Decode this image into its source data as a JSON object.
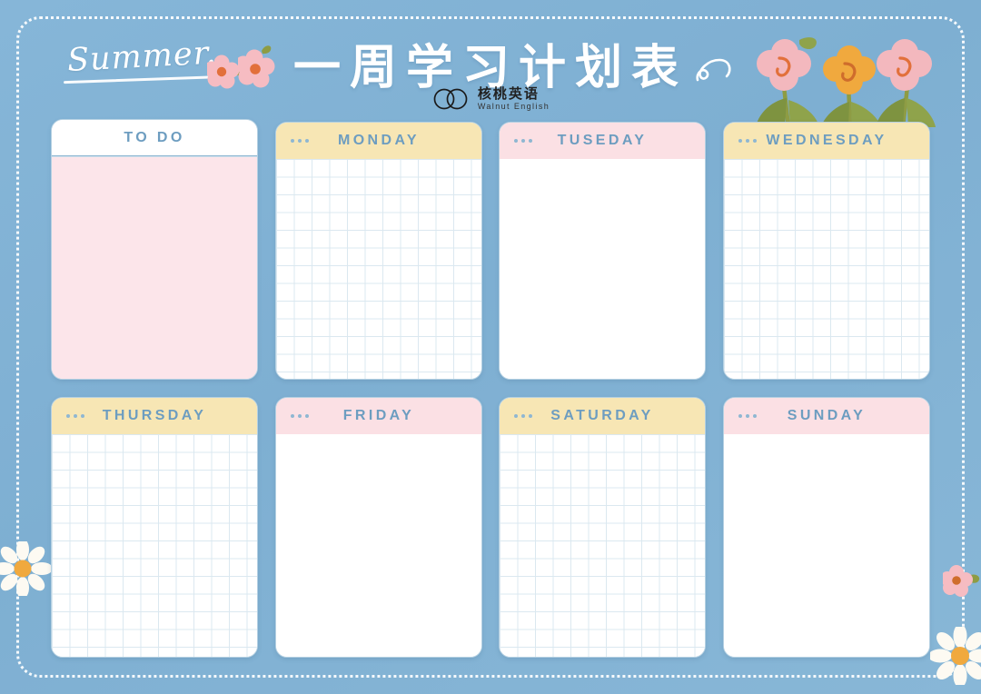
{
  "page": {
    "background_color": "#7fb1d4",
    "border_style": "white-dotted-rounded"
  },
  "header": {
    "script_label": "Summer.",
    "title": "一周学习计划表",
    "brand": {
      "logo_icon": "two-overlapping-circles-icon",
      "name_cn": "核桃英语",
      "name_en": "Walnut English"
    },
    "swirl_icon": "swirl-flourish-icon"
  },
  "decorations": [
    {
      "name": "pink-blossom-icon",
      "color": "#f5b3b9"
    },
    {
      "name": "pink-blossom-icon",
      "color": "#f5b3b9"
    },
    {
      "name": "tulip-flowers-icon",
      "colors": [
        "#f3b5bb",
        "#f0aa3f",
        "#f3b5bb"
      ]
    },
    {
      "name": "white-daisy-icon",
      "color": "#fdfaf2"
    },
    {
      "name": "white-daisy-icon",
      "color": "#fdfaf2"
    },
    {
      "name": "pink-blossom-icon",
      "color": "#f5b3b9"
    }
  ],
  "cards": [
    {
      "id": "todo",
      "label": "TO DO",
      "head_style": "white",
      "body_style": "pink",
      "has_dots": false
    },
    {
      "id": "monday",
      "label": "MONDAY",
      "head_style": "cream",
      "body_style": "grid",
      "has_dots": true
    },
    {
      "id": "tuesday",
      "label": "TUSEDAY",
      "head_style": "pink",
      "body_style": "plain",
      "has_dots": true
    },
    {
      "id": "wednesday",
      "label": "WEDNESDAY",
      "head_style": "cream",
      "body_style": "grid",
      "has_dots": true
    },
    {
      "id": "thursday",
      "label": "THURSDAY",
      "head_style": "cream",
      "body_style": "grid",
      "has_dots": true
    },
    {
      "id": "friday",
      "label": "FRIDAY",
      "head_style": "pink",
      "body_style": "plain",
      "has_dots": true
    },
    {
      "id": "saturday",
      "label": "SATURDAY",
      "head_style": "cream",
      "body_style": "grid",
      "has_dots": true
    },
    {
      "id": "sunday",
      "label": "SUNDAY",
      "head_style": "pink",
      "body_style": "plain",
      "has_dots": true
    }
  ],
  "colors": {
    "cream_header": "#f7e6b4",
    "pink_header": "#fbe0e4",
    "todo_body": "#fce5ea",
    "title_text": "#6d9dc0",
    "grid_line": "#dbe8f0"
  }
}
